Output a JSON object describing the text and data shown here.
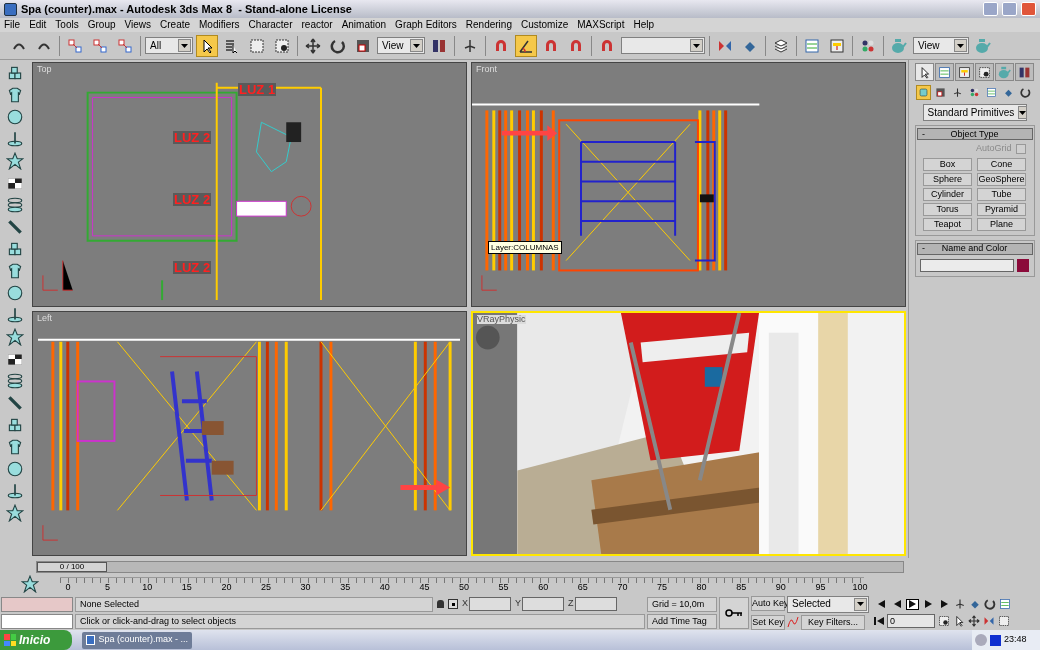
{
  "window": {
    "title": "Spa (counter).max - Autodesk 3ds Max 8  - Stand-alone License"
  },
  "menu": [
    "File",
    "Edit",
    "Tools",
    "Group",
    "Views",
    "Create",
    "Modifiers",
    "Character",
    "reactor",
    "Animation",
    "Graph Editors",
    "Rendering",
    "Customize",
    "MAXScript",
    "Help"
  ],
  "toolbar": [
    {
      "kind": "undo",
      "selected": false
    },
    {
      "kind": "redo",
      "selected": false
    },
    {
      "kind": "sep"
    },
    {
      "kind": "link",
      "selected": false
    },
    {
      "kind": "unlink",
      "selected": false
    },
    {
      "kind": "bind",
      "selected": false
    },
    {
      "kind": "sep"
    },
    {
      "kind": "dropdown",
      "value": "All"
    },
    {
      "kind": "select",
      "selected": true
    },
    {
      "kind": "list",
      "selected": false
    },
    {
      "kind": "region",
      "selected": false
    },
    {
      "kind": "window",
      "selected": false
    },
    {
      "kind": "sep"
    },
    {
      "kind": "move",
      "selected": false
    },
    {
      "kind": "rotate",
      "selected": false
    },
    {
      "kind": "scale",
      "selected": false
    },
    {
      "kind": "dropdown",
      "value": "View"
    },
    {
      "kind": "pivot",
      "selected": false
    },
    {
      "kind": "sep"
    },
    {
      "kind": "manipulate",
      "selected": false
    },
    {
      "kind": "sep"
    },
    {
      "kind": "snap",
      "selected": false
    },
    {
      "kind": "angle",
      "selected": true
    },
    {
      "kind": "percent",
      "selected": false
    },
    {
      "kind": "spinner",
      "selected": false
    },
    {
      "kind": "sep"
    },
    {
      "kind": "named",
      "selected": false
    },
    {
      "kind": "dropdown"
    },
    {
      "kind": "sep"
    },
    {
      "kind": "mirror",
      "selected": false
    },
    {
      "kind": "align",
      "selected": false
    },
    {
      "kind": "sep"
    },
    {
      "kind": "layers",
      "selected": false
    },
    {
      "kind": "sep"
    },
    {
      "kind": "curve",
      "selected": false
    },
    {
      "kind": "schematic",
      "selected": false
    },
    {
      "kind": "sep"
    },
    {
      "kind": "material",
      "selected": false
    },
    {
      "kind": "sep"
    },
    {
      "kind": "render",
      "selected": false
    },
    {
      "kind": "dropdown",
      "value": "View"
    },
    {
      "kind": "teapot",
      "selected": false
    }
  ],
  "viewports": [
    {
      "label": "Top",
      "active": false,
      "kind": "wire",
      "annotations": [
        "LUZ 1",
        "LUZ 2",
        "LUZ 2",
        "LUZ 2"
      ]
    },
    {
      "label": "Front",
      "active": false,
      "kind": "wire",
      "tooltip": "Layer:COLUMNAS"
    },
    {
      "label": "Left",
      "active": false,
      "kind": "wire"
    },
    {
      "label": "VRayPhysic",
      "active": true,
      "kind": "picture"
    }
  ],
  "command_panel": {
    "tabs": [
      {
        "selected": true
      },
      {
        "selected": false
      },
      {
        "selected": false
      },
      {
        "selected": false
      },
      {
        "selected": false
      },
      {
        "selected": false
      }
    ],
    "categories": [
      {
        "selected": true
      },
      {
        "selected": false
      },
      {
        "selected": false
      },
      {
        "selected": false
      },
      {
        "selected": false
      },
      {
        "selected": false
      },
      {
        "selected": false
      }
    ],
    "dropdown": "Standard Primitives",
    "object_type": {
      "sign": "-",
      "title": "Object Type",
      "autogrid": {
        "label": "AutoGrid",
        "checked": false,
        "disabled": true
      },
      "buttons": [
        "Box",
        "Cone",
        "Sphere",
        "GeoSphere",
        "Cylinder",
        "Tube",
        "Torus",
        "Pyramid",
        "Teapot",
        "Plane"
      ]
    },
    "name_and_color": {
      "sign": "-",
      "title": "Name and Color",
      "color": "#8b0a3a"
    }
  },
  "time_slider": {
    "label": "0 / 100",
    "level": 0
  },
  "track_ticks": [
    "0",
    "5",
    "10",
    "15",
    "20",
    "25",
    "30",
    "35",
    "40",
    "45",
    "50",
    "55",
    "60",
    "65",
    "70",
    "75",
    "80",
    "85",
    "90",
    "95",
    "100"
  ],
  "status": {
    "selection": "None Selected",
    "prompt": "Click or click-and-drag to select objects",
    "coords": [
      "X",
      "Y",
      "Z"
    ],
    "grid": "Grid = 10,0m",
    "time_tag": "Add Time Tag",
    "auto_key": "Auto Key",
    "set_key": "Set Key",
    "key_mode": "Selected",
    "key_filters": "Key Filters...",
    "frame": "0"
  },
  "taskbar": {
    "start": "Inicio",
    "tasks": [
      {
        "label": "Spa (counter).max - ...",
        "selected": false
      }
    ],
    "clock": "23:48"
  }
}
